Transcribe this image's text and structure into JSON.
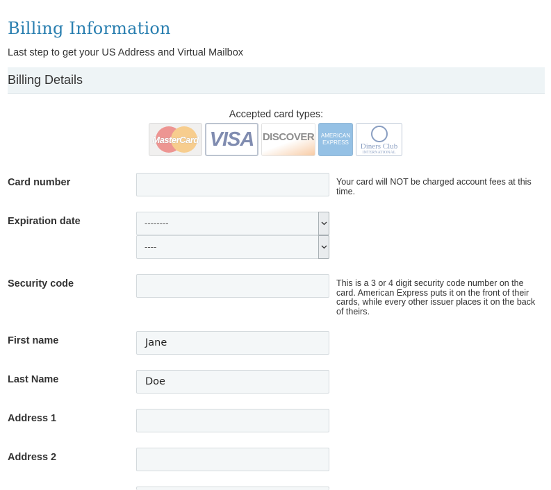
{
  "page": {
    "title": "Billing Information",
    "subtitle": "Last step to get your US Address and Virtual Mailbox"
  },
  "section": {
    "title": "Billing Details"
  },
  "cards": {
    "label": "Accepted card types:",
    "items": [
      {
        "name": "mastercard",
        "text": "MasterCard"
      },
      {
        "name": "visa",
        "text": "VISA"
      },
      {
        "name": "discover",
        "text": "DISCOVER"
      },
      {
        "name": "amex",
        "text": "AMERICAN EXPRESS"
      },
      {
        "name": "diners",
        "text": "Diners Club",
        "subtext": "INTERNATIONAL"
      }
    ]
  },
  "form": {
    "card_number": {
      "label": "Card number",
      "value": "",
      "help": "Your card will NOT be charged account fees at this time."
    },
    "expiration": {
      "label": "Expiration date",
      "month_value": "--------",
      "year_value": "----"
    },
    "security_code": {
      "label": "Security code",
      "value": "",
      "help": "This is a 3 or 4 digit security code number on the card. American Express puts it on the front of their cards, while every other issuer places it on the back of theirs."
    },
    "first_name": {
      "label": "First name",
      "value": "Jane"
    },
    "last_name": {
      "label": "Last Name",
      "value": "Doe"
    },
    "address1": {
      "label": "Address 1",
      "value": ""
    },
    "address2": {
      "label": "Address 2",
      "value": ""
    }
  },
  "colors": {
    "title": "#2a7fb0",
    "section_bg": "#eef4f6",
    "field_bg": "#f4f7f8"
  }
}
